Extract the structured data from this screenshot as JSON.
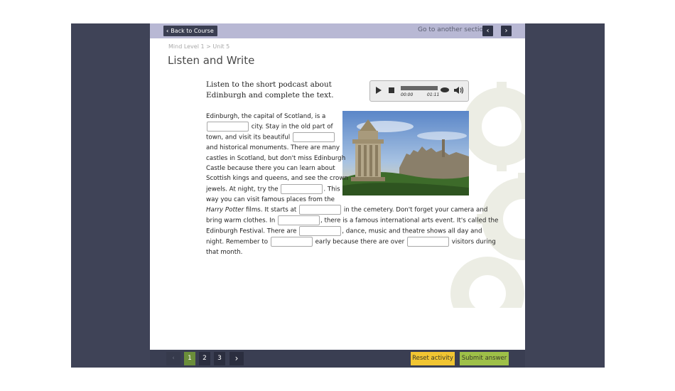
{
  "header": {
    "back_label": "Back to Course",
    "goto_label": "Go to another section",
    "prev_icon": "chevron-left-icon",
    "next_icon": "chevron-right-icon"
  },
  "breadcrumb": "Mind Level 1 > Unit 5",
  "page_title": "Listen and Write",
  "instruction": "Listen to the short podcast about Edinburgh and complete the text.",
  "player": {
    "current_time": "00:00",
    "duration": "01:11"
  },
  "passage": {
    "l1": "Edinburgh, the capital of Scotland, is a",
    "l2": "city. Stay in the old part of",
    "l3": "town, and visit its beautiful",
    "l4": "and historical monuments. There are many",
    "l5": "castles in Scotland, but don't miss Edinburgh",
    "l6": "Castle because there you can learn about",
    "l7": "Scottish kings and queens, and see the crown",
    "l8a": "jewels. At night, try the",
    "l8b": ". This",
    "l9": "way you can visit famous places from the",
    "l10a": "Harry Potter",
    "l10b": " films. It starts at",
    "l10c": "in the cemetery. Don't forget your camera and",
    "l11a": "bring warm clothes. In",
    "l11b": ", there is a famous international arts event. It's called the",
    "l12a": "Edinburgh Festival. There are",
    "l12b": ", dance, music and theatre shows all day and",
    "l13a": "night. Remember to",
    "l13b": "early because there are over",
    "l13c": "visitors during",
    "l14": "that month."
  },
  "pagination": {
    "prev": "‹",
    "pages": [
      "1",
      "2",
      "3"
    ],
    "active": "1",
    "next": "›"
  },
  "actions": {
    "reset": "Reset activity",
    "submit": "Submit answer"
  },
  "colors": {
    "frame": "#3f4357",
    "topbar": "#b8b8d4",
    "active_page": "#6b8e3a",
    "reset": "#f1c532",
    "submit": "#9ec048"
  }
}
